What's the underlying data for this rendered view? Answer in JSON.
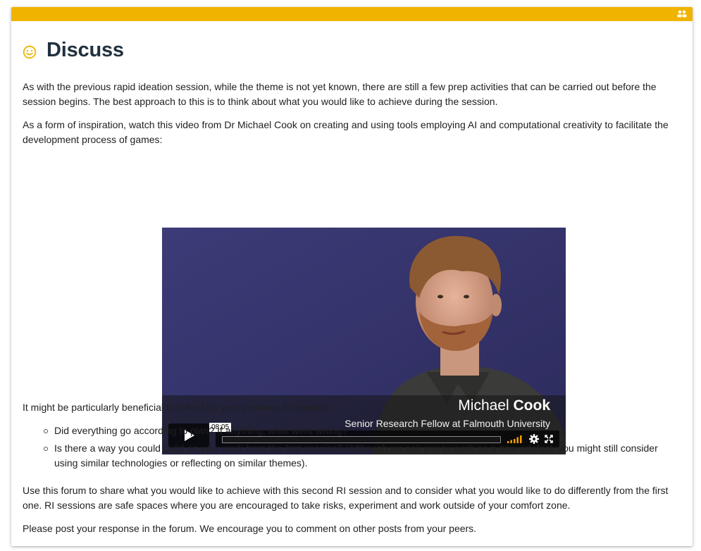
{
  "header": {
    "title": "Discuss",
    "type_icon": "smile-icon",
    "group_icon": "group-icon",
    "accent_color": "#f0b400"
  },
  "content": {
    "intro": "As with the previous rapid ideation session, while the theme is not yet known, there are still a few prep activities that can be carried out before the session begins. The best approach to this is to think about what you would like to achieve during the session.",
    "inspiration": "As a form of inspiration, watch this video from Dr Michael Cook on creating and using tools employing AI and computational creativity to facilitate the development process of games:",
    "reflect_intro": "It might be particularly beneficial to reflect on your previous RI session:",
    "bullets": [
      "Did everything go according to plan? If anything, what went wrong?",
      "Is there a way you could build on your work from the first session? (Although we ask you to work on a new artefact, you might still consider using similar technologies or reflecting on similar themes)."
    ],
    "forum_use": "Use this forum to share what you would like to achieve with this second RI session and to consider what you would like to do differently from the first one. RI sessions are safe spaces where you are encouraged to take risks, experiment and work outside of your comfort zone.",
    "post_request": "Please post your response in the forum. We encourage you to comment on other posts from your peers."
  },
  "video": {
    "speaker_first": "Michael",
    "speaker_last": "Cook",
    "speaker_role": "Senior Research Fellow at Falmouth University",
    "time": "08:05",
    "progress": 0,
    "controls": [
      "play-icon",
      "volume-icon",
      "gear-icon",
      "fullscreen-icon"
    ]
  }
}
